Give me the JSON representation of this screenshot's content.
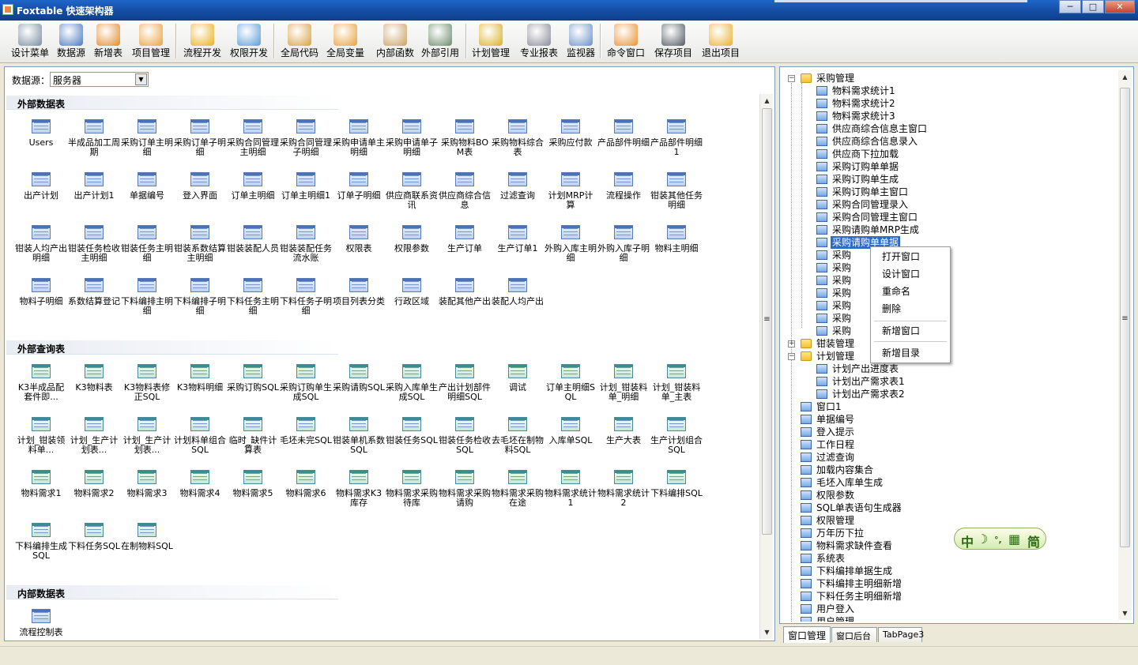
{
  "window": {
    "title": "Foxtable 快速架构器",
    "minimize": "─",
    "maximize": "□",
    "close": "✕"
  },
  "toolbar": [
    {
      "label": "设计菜单",
      "icon": "tools-icon",
      "color": "#7a8ca0"
    },
    {
      "label": "数据源",
      "icon": "database-icon",
      "color": "#4a78c0"
    },
    {
      "label": "新增表",
      "icon": "new-table-icon",
      "color": "#e08a2a"
    },
    {
      "label": "项目管理",
      "icon": "project-icon",
      "color": "#e8a23a"
    },
    {
      "label": "流程开发",
      "icon": "gear-icon",
      "color": "#e8b020"
    },
    {
      "label": "权限开发",
      "icon": "users-icon",
      "color": "#5a9ad8"
    },
    {
      "label": "全局代码",
      "icon": "books-icon",
      "color": "#d8a040"
    },
    {
      "label": "全局变量",
      "icon": "pencil-icon",
      "color": "#e8a03a"
    },
    {
      "label": "内部函数",
      "icon": "function-icon",
      "color": "#c8a060"
    },
    {
      "label": "外部引用",
      "icon": "reference-icon",
      "color": "#6a8a6a"
    },
    {
      "label": "计划管理",
      "icon": "clock-icon",
      "color": "#d8b020"
    },
    {
      "label": "专业报表",
      "icon": "report-icon",
      "color": "#8a8a9a"
    },
    {
      "label": "监视器",
      "icon": "magnifier-icon",
      "color": "#6a90c8"
    },
    {
      "label": "命令窗口",
      "icon": "command-icon",
      "color": "#e89030"
    },
    {
      "label": "保存项目",
      "icon": "save-icon",
      "color": "#505860"
    },
    {
      "label": "退出项目",
      "icon": "exit-icon",
      "color": "#e8b030"
    }
  ],
  "datasource": {
    "label": "数据源：",
    "value": "服务器"
  },
  "sections": [
    {
      "title": "外部数据表",
      "kind": "table",
      "items": [
        "Users",
        "半成品加工周期",
        "采购订单主明细",
        "采购订单子明细",
        "采购合同管理主明细",
        "采购合同管理子明细",
        "采购申请单主明细",
        "采购申请单子明细",
        "采购物料BOM表",
        "采购物料综合表",
        "采购应付款",
        "产品部件明细",
        "产品部件明细1",
        "出产计划",
        "出产计划1",
        "单据编号",
        "登入界面",
        "订单主明细",
        "订单主明细1",
        "订单子明细",
        "供应商联系资讯",
        "供应商综合信息",
        "过滤查询",
        "计划MRP计算",
        "流程操作",
        "钳装其他任务明细",
        "钳装人均产出明细",
        "钳装任务检收主明细",
        "钳装任务主明细",
        "钳装系数结算主明细",
        "钳装装配人员",
        "钳装装配任务流水账",
        "权限表",
        "权限参数",
        "生产订单",
        "生产订单1",
        "外购入库主明细",
        "外购入库子明细",
        "物料主明细",
        "物料子明细",
        "系数结算登记",
        "下料编排主明细",
        "下料编排子明细",
        "下料任务主明细",
        "下料任务子明细",
        "项目列表分类",
        "行政区域",
        "装配其他产出",
        "装配人均产出"
      ]
    },
    {
      "title": "外部查询表",
      "kind": "query",
      "items": [
        "K3半成品配套件即...",
        "K3物料表",
        "K3物料表修正SQL",
        "K3物料明细",
        "采购订购SQL",
        "采购订购单生成SQL",
        "采购请购SQL",
        "采购入库单生成SQL",
        "产出计划部件明细SQL",
        "调试",
        "订单主明细SQL",
        "计划_钳装料单_明细",
        "计划_钳装料单_主表",
        "计划_钳装领料单...",
        "计划_生产计划表...",
        "计划_生产计划表...",
        "计划料单组合SQL",
        "临时_缺件计算表",
        "毛坯未完SQL",
        "钳装单机系数SQL",
        "钳装任务SQL",
        "钳装任务检收SQL",
        "去毛坯在制物料SQL",
        "入库单SQL",
        "生产大表",
        "生产计划组合SQL",
        "物料需求1",
        "物料需求2",
        "物料需求3",
        "物料需求4",
        "物料需求5",
        "物料需求6",
        "物料需求K3库存",
        "物料需求采购待库",
        "物料需求采购请购",
        "物料需求采购在途",
        "物料需求统计1",
        "物料需求统计2",
        "下料编排SQL",
        "下料编排生成SQL",
        "下料任务SQL",
        "在制物料SQL"
      ]
    },
    {
      "title": "内部数据表",
      "kind": "table",
      "items": [
        "流程控制表"
      ]
    }
  ],
  "tree": {
    "nodes": [
      {
        "label": "采购管理",
        "type": "folder",
        "level": 1,
        "expander": "−"
      },
      {
        "label": "物料需求统计1",
        "type": "node",
        "level": 2
      },
      {
        "label": "物料需求统计2",
        "type": "node",
        "level": 2
      },
      {
        "label": "物料需求统计3",
        "type": "node",
        "level": 2
      },
      {
        "label": "供应商综合信息主窗口",
        "type": "node",
        "level": 2
      },
      {
        "label": "供应商综合信息录入",
        "type": "node",
        "level": 2
      },
      {
        "label": "供应商下拉加载",
        "type": "node",
        "level": 2
      },
      {
        "label": "采购订购单单据",
        "type": "node",
        "level": 2
      },
      {
        "label": "采购订购单生成",
        "type": "node",
        "level": 2
      },
      {
        "label": "采购订购单主窗口",
        "type": "node",
        "level": 2
      },
      {
        "label": "采购合同管理录入",
        "type": "node",
        "level": 2
      },
      {
        "label": "采购合同管理主窗口",
        "type": "node",
        "level": 2
      },
      {
        "label": "采购请购单MRP生成",
        "type": "node",
        "level": 2
      },
      {
        "label": "采购请购单单据",
        "type": "node",
        "level": 2,
        "selected": true
      },
      {
        "label": "采购",
        "type": "node",
        "level": 2
      },
      {
        "label": "采购",
        "type": "node",
        "level": 2
      },
      {
        "label": "采购",
        "type": "node",
        "level": 2
      },
      {
        "label": "采购",
        "type": "node",
        "level": 2
      },
      {
        "label": "采购",
        "type": "node",
        "level": 2
      },
      {
        "label": "采购",
        "type": "node",
        "level": 2
      },
      {
        "label": "采购",
        "type": "node",
        "level": 2
      },
      {
        "label": "钳装管理",
        "type": "folder",
        "level": 1,
        "expander": "+"
      },
      {
        "label": "计划管理",
        "type": "folder",
        "level": 1,
        "expander": "−"
      },
      {
        "label": "计划产出进度表",
        "type": "node",
        "level": 2
      },
      {
        "label": "计划出产需求表1",
        "type": "node",
        "level": 2
      },
      {
        "label": "计划出产需求表2",
        "type": "node",
        "level": 2
      },
      {
        "label": "窗口1",
        "type": "node",
        "level": 1
      },
      {
        "label": "单据编号",
        "type": "node",
        "level": 1
      },
      {
        "label": "登入提示",
        "type": "node",
        "level": 1
      },
      {
        "label": "工作日程",
        "type": "node",
        "level": 1
      },
      {
        "label": "过滤查询",
        "type": "node",
        "level": 1
      },
      {
        "label": "加载内容集合",
        "type": "node",
        "level": 1
      },
      {
        "label": "毛坯入库单生成",
        "type": "node",
        "level": 1
      },
      {
        "label": "权限参数",
        "type": "node",
        "level": 1
      },
      {
        "label": "SQL单表语句生成器",
        "type": "node",
        "level": 1
      },
      {
        "label": "权限管理",
        "type": "node",
        "level": 1
      },
      {
        "label": "万年历下拉",
        "type": "node",
        "level": 1
      },
      {
        "label": "物料需求缺件查看",
        "type": "node",
        "level": 1
      },
      {
        "label": "系统表",
        "type": "node",
        "level": 1
      },
      {
        "label": "下料编排单据生成",
        "type": "node",
        "level": 1
      },
      {
        "label": "下料编排主明细新增",
        "type": "node",
        "level": 1
      },
      {
        "label": "下料任务主明细新增",
        "type": "node",
        "level": 1
      },
      {
        "label": "用户登入",
        "type": "node",
        "level": 1
      },
      {
        "label": "用户管理",
        "type": "node",
        "level": 1
      }
    ]
  },
  "context_menu": {
    "items": [
      "打开窗口",
      "设计窗口",
      "重命名",
      "删除",
      "新增窗口",
      "新增目录"
    ]
  },
  "ime": {
    "mode": "中",
    "moon": "☽",
    "punct": "°,",
    "keyboard": "▦",
    "charset": "简"
  },
  "tabs": [
    "窗口管理",
    "窗口后台",
    "TabPage3"
  ],
  "scroll": {
    "up": "▲",
    "down": "▼",
    "grip": "≡"
  }
}
